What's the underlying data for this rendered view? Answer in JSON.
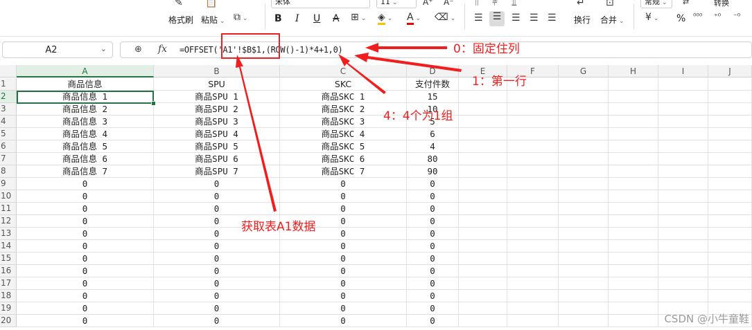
{
  "ribbon": {
    "format_painter": "格式刷",
    "paste": "粘贴",
    "font_name": "宋体",
    "font_size": "11",
    "bold": "B",
    "italic": "I",
    "underline": "U",
    "strikethrough": "A",
    "font_color_letter": "A",
    "wrap": "换行",
    "merge": "合并",
    "number_format": "常规",
    "percent": "%",
    "convert": "转换"
  },
  "formula_bar": {
    "cell_ref": "A2",
    "fx_label": "fx",
    "formula": "=OFFSET('A1'!$B$1,(ROW()-1)*4+1,0)"
  },
  "columns": [
    "A",
    "B",
    "C",
    "D",
    "E",
    "F",
    "G",
    "H",
    "I",
    "J"
  ],
  "rows": [
    {
      "num": "1",
      "a": "商品信息",
      "b": "SPU",
      "c": "SKC",
      "d": "支付件数"
    },
    {
      "num": "2",
      "a": "商品信息 1",
      "b": "商品SPU 1",
      "c": "商品SKC 1",
      "d": "15"
    },
    {
      "num": "3",
      "a": "商品信息 2",
      "b": "商品SPU 2",
      "c": "商品SKC 2",
      "d": "10"
    },
    {
      "num": "4",
      "a": "商品信息 3",
      "b": "商品SPU 3",
      "c": "商品SKC 3",
      "d": "5"
    },
    {
      "num": "5",
      "a": "商品信息 4",
      "b": "商品SPU 4",
      "c": "商品SKC 4",
      "d": "6"
    },
    {
      "num": "6",
      "a": "商品信息 5",
      "b": "商品SPU 5",
      "c": "商品SKC 5",
      "d": "4"
    },
    {
      "num": "7",
      "a": "商品信息 6",
      "b": "商品SPU 6",
      "c": "商品SKC 6",
      "d": "80"
    },
    {
      "num": "8",
      "a": "商品信息 7",
      "b": "商品SPU 7",
      "c": "商品SKC 7",
      "d": "90"
    },
    {
      "num": "9",
      "a": "0",
      "b": "0",
      "c": "0",
      "d": "0"
    },
    {
      "num": "10",
      "a": "0",
      "b": "0",
      "c": "0",
      "d": "0"
    },
    {
      "num": "11",
      "a": "0",
      "b": "0",
      "c": "0",
      "d": "0"
    },
    {
      "num": "12",
      "a": "0",
      "b": "0",
      "c": "0",
      "d": "0"
    },
    {
      "num": "13",
      "a": "0",
      "b": "0",
      "c": "0",
      "d": "0"
    },
    {
      "num": "14",
      "a": "0",
      "b": "0",
      "c": "0",
      "d": "0"
    },
    {
      "num": "15",
      "a": "0",
      "b": "0",
      "c": "0",
      "d": "0"
    },
    {
      "num": "16",
      "a": "0",
      "b": "0",
      "c": "0",
      "d": "0"
    },
    {
      "num": "17",
      "a": "0",
      "b": "0",
      "c": "0",
      "d": "0"
    },
    {
      "num": "18",
      "a": "0",
      "b": "0",
      "c": "0",
      "d": "0"
    },
    {
      "num": "19",
      "a": "0",
      "b": "0",
      "c": "0",
      "d": "0"
    },
    {
      "num": "20",
      "a": "0",
      "b": "0",
      "c": "0",
      "d": "0"
    }
  ],
  "annotations": {
    "fixed_col": "0：固定住列",
    "first_row": "1：第一行",
    "group": "4：4个为1组",
    "get_data": "获取表A1数据"
  },
  "watermark": "CSDN @小牛童鞋",
  "colors": {
    "accent": "#217346",
    "annotation": "#f21d1d"
  }
}
